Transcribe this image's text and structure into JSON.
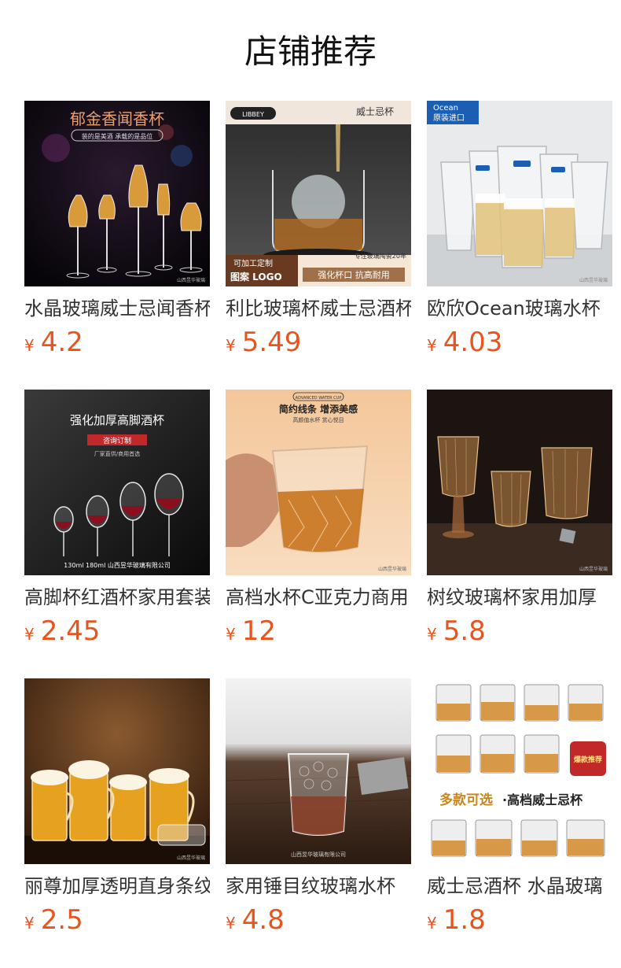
{
  "page": {
    "title": "店铺推荐"
  },
  "currency_symbol": "¥",
  "products": [
    {
      "name": "水晶玻璃威士忌闻香杯",
      "price": "4.2",
      "image_text": {
        "headline": "郁金香闻香杯",
        "sub": "装的是美酒 承载的是品位",
        "watermark": "山西昱华玻璃"
      }
    },
    {
      "name": "利比玻璃杯威士忌酒杯",
      "price": "5.49",
      "image_text": {
        "brand": "LIBBEY",
        "tag": "威士忌杯",
        "custom1": "可加工定制",
        "custom2": "图案 LOGO",
        "note": "专注玻璃陶瓷20年",
        "bottom": "强化杯口 抗高耐用"
      }
    },
    {
      "name": "欧欣Ocean玻璃水杯",
      "price": "4.03",
      "image_text": {
        "brand": "Ocean",
        "sub": "原装进口",
        "watermark": "山西昱华玻璃"
      }
    },
    {
      "name": "高脚杯红酒杯家用套装",
      "price": "2.45",
      "image_text": {
        "headline": "强化加厚高脚酒杯",
        "badge": "咨询订制",
        "sub": "厂家直供/商用首选",
        "bottom": "130ml 180ml 山西昱华玻璃有限公司"
      }
    },
    {
      "name": "高档水杯C亚克力商用",
      "price": "12",
      "image_text": {
        "top": "ADVANCED WATER CUP",
        "headline": "简约线条 增添美感",
        "sub": "高颜值水杯 赏心悦目",
        "watermark": "山西昱华玻璃"
      }
    },
    {
      "name": "树纹玻璃杯家用加厚",
      "price": "5.8",
      "image_text": {
        "watermark": "山西昱华玻璃"
      }
    },
    {
      "name": "丽尊加厚透明直身条纹",
      "price": "2.5",
      "image_text": {
        "watermark": "山西昱华玻璃"
      }
    },
    {
      "name": "家用锤目纹玻璃水杯",
      "price": "4.8",
      "image_text": {
        "watermark": "山西昱华玻璃有限公司"
      }
    },
    {
      "name": "威士忌酒杯 水晶玻璃",
      "price": "1.8",
      "image_text": {
        "badge": "爆款推荐",
        "headline": "多款可选",
        "headline2": "·高档威士忌杯"
      }
    }
  ],
  "colors": {
    "price": "#e8541e",
    "title": "#111111",
    "name": "#333333"
  }
}
